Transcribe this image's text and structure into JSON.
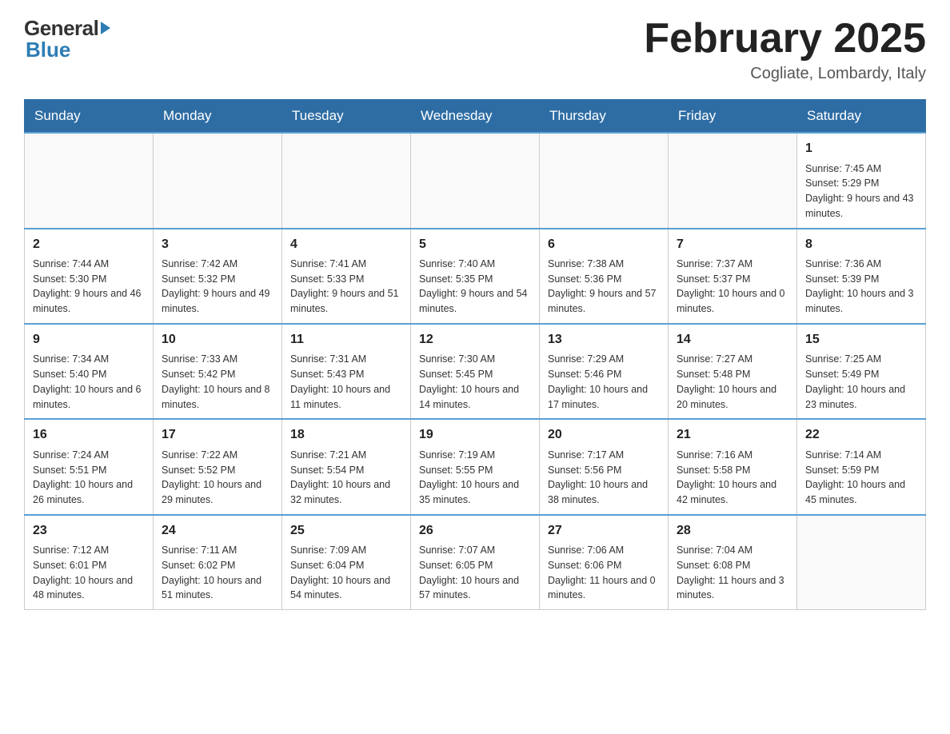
{
  "header": {
    "logo_general": "General",
    "logo_blue": "Blue",
    "month_title": "February 2025",
    "location": "Cogliate, Lombardy, Italy"
  },
  "weekdays": [
    "Sunday",
    "Monday",
    "Tuesday",
    "Wednesday",
    "Thursday",
    "Friday",
    "Saturday"
  ],
  "weeks": [
    [
      {
        "day": "",
        "info": ""
      },
      {
        "day": "",
        "info": ""
      },
      {
        "day": "",
        "info": ""
      },
      {
        "day": "",
        "info": ""
      },
      {
        "day": "",
        "info": ""
      },
      {
        "day": "",
        "info": ""
      },
      {
        "day": "1",
        "info": "Sunrise: 7:45 AM\nSunset: 5:29 PM\nDaylight: 9 hours and 43 minutes."
      }
    ],
    [
      {
        "day": "2",
        "info": "Sunrise: 7:44 AM\nSunset: 5:30 PM\nDaylight: 9 hours and 46 minutes."
      },
      {
        "day": "3",
        "info": "Sunrise: 7:42 AM\nSunset: 5:32 PM\nDaylight: 9 hours and 49 minutes."
      },
      {
        "day": "4",
        "info": "Sunrise: 7:41 AM\nSunset: 5:33 PM\nDaylight: 9 hours and 51 minutes."
      },
      {
        "day": "5",
        "info": "Sunrise: 7:40 AM\nSunset: 5:35 PM\nDaylight: 9 hours and 54 minutes."
      },
      {
        "day": "6",
        "info": "Sunrise: 7:38 AM\nSunset: 5:36 PM\nDaylight: 9 hours and 57 minutes."
      },
      {
        "day": "7",
        "info": "Sunrise: 7:37 AM\nSunset: 5:37 PM\nDaylight: 10 hours and 0 minutes."
      },
      {
        "day": "8",
        "info": "Sunrise: 7:36 AM\nSunset: 5:39 PM\nDaylight: 10 hours and 3 minutes."
      }
    ],
    [
      {
        "day": "9",
        "info": "Sunrise: 7:34 AM\nSunset: 5:40 PM\nDaylight: 10 hours and 6 minutes."
      },
      {
        "day": "10",
        "info": "Sunrise: 7:33 AM\nSunset: 5:42 PM\nDaylight: 10 hours and 8 minutes."
      },
      {
        "day": "11",
        "info": "Sunrise: 7:31 AM\nSunset: 5:43 PM\nDaylight: 10 hours and 11 minutes."
      },
      {
        "day": "12",
        "info": "Sunrise: 7:30 AM\nSunset: 5:45 PM\nDaylight: 10 hours and 14 minutes."
      },
      {
        "day": "13",
        "info": "Sunrise: 7:29 AM\nSunset: 5:46 PM\nDaylight: 10 hours and 17 minutes."
      },
      {
        "day": "14",
        "info": "Sunrise: 7:27 AM\nSunset: 5:48 PM\nDaylight: 10 hours and 20 minutes."
      },
      {
        "day": "15",
        "info": "Sunrise: 7:25 AM\nSunset: 5:49 PM\nDaylight: 10 hours and 23 minutes."
      }
    ],
    [
      {
        "day": "16",
        "info": "Sunrise: 7:24 AM\nSunset: 5:51 PM\nDaylight: 10 hours and 26 minutes."
      },
      {
        "day": "17",
        "info": "Sunrise: 7:22 AM\nSunset: 5:52 PM\nDaylight: 10 hours and 29 minutes."
      },
      {
        "day": "18",
        "info": "Sunrise: 7:21 AM\nSunset: 5:54 PM\nDaylight: 10 hours and 32 minutes."
      },
      {
        "day": "19",
        "info": "Sunrise: 7:19 AM\nSunset: 5:55 PM\nDaylight: 10 hours and 35 minutes."
      },
      {
        "day": "20",
        "info": "Sunrise: 7:17 AM\nSunset: 5:56 PM\nDaylight: 10 hours and 38 minutes."
      },
      {
        "day": "21",
        "info": "Sunrise: 7:16 AM\nSunset: 5:58 PM\nDaylight: 10 hours and 42 minutes."
      },
      {
        "day": "22",
        "info": "Sunrise: 7:14 AM\nSunset: 5:59 PM\nDaylight: 10 hours and 45 minutes."
      }
    ],
    [
      {
        "day": "23",
        "info": "Sunrise: 7:12 AM\nSunset: 6:01 PM\nDaylight: 10 hours and 48 minutes."
      },
      {
        "day": "24",
        "info": "Sunrise: 7:11 AM\nSunset: 6:02 PM\nDaylight: 10 hours and 51 minutes."
      },
      {
        "day": "25",
        "info": "Sunrise: 7:09 AM\nSunset: 6:04 PM\nDaylight: 10 hours and 54 minutes."
      },
      {
        "day": "26",
        "info": "Sunrise: 7:07 AM\nSunset: 6:05 PM\nDaylight: 10 hours and 57 minutes."
      },
      {
        "day": "27",
        "info": "Sunrise: 7:06 AM\nSunset: 6:06 PM\nDaylight: 11 hours and 0 minutes."
      },
      {
        "day": "28",
        "info": "Sunrise: 7:04 AM\nSunset: 6:08 PM\nDaylight: 11 hours and 3 minutes."
      },
      {
        "day": "",
        "info": ""
      }
    ]
  ]
}
